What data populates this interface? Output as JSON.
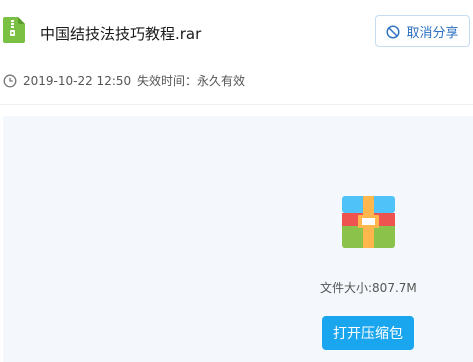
{
  "file": {
    "name": "中国结技法技巧教程.rar",
    "icon": "zip-file-icon",
    "icon_color": "#7ac143"
  },
  "actions": {
    "cancel_share_label": "取消分享",
    "cancel_share_icon": "ban-icon",
    "accent_color": "#2b6fc2"
  },
  "meta": {
    "date": "2019-10-22 12:50",
    "expiry": "失效时间：永久有效",
    "clock_icon": "clock-icon"
  },
  "preview": {
    "archive_icon": "archive-icon",
    "size_label": "文件大小:807.7M",
    "open_button_label": "打开压缩包",
    "open_button_color": "#1aa6ee",
    "background": "#f4f8fc"
  }
}
